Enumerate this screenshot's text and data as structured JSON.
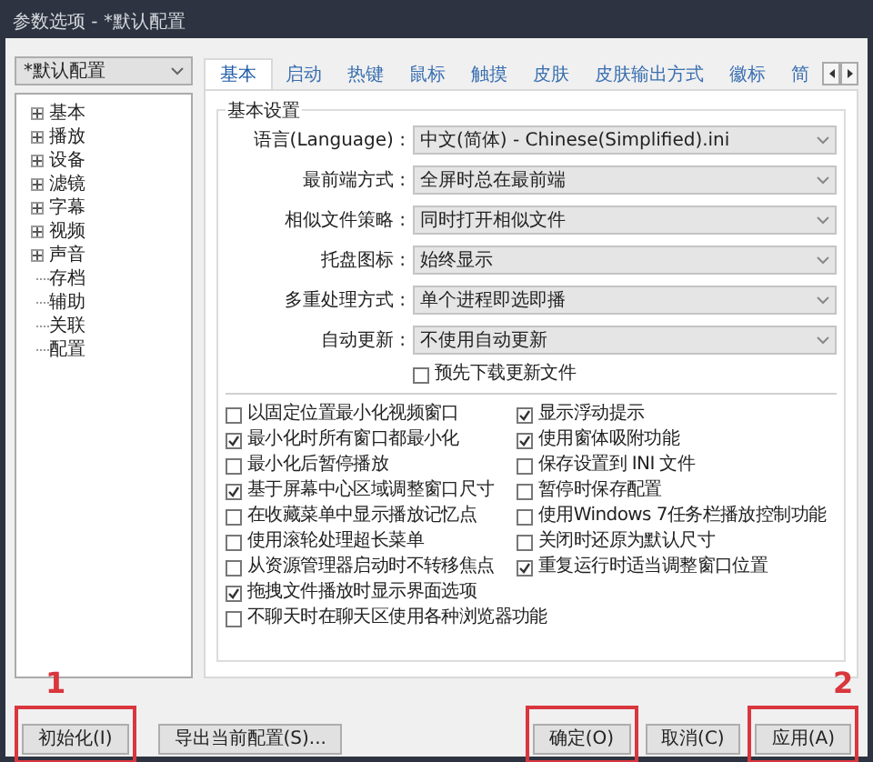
{
  "window": {
    "title": "参数选项 - *默认配置"
  },
  "profile_select": {
    "value": "*默认配置"
  },
  "tree": [
    {
      "label": "基本",
      "kind": "group"
    },
    {
      "label": "播放",
      "kind": "group"
    },
    {
      "label": "设备",
      "kind": "group"
    },
    {
      "label": "滤镜",
      "kind": "group"
    },
    {
      "label": "字幕",
      "kind": "group"
    },
    {
      "label": "视频",
      "kind": "group"
    },
    {
      "label": "声音",
      "kind": "group"
    },
    {
      "label": "存档",
      "kind": "leaf"
    },
    {
      "label": "辅助",
      "kind": "leaf"
    },
    {
      "label": "关联",
      "kind": "leaf"
    },
    {
      "label": "配置",
      "kind": "leaf"
    }
  ],
  "tabs": [
    {
      "label": "基本",
      "selected": true
    },
    {
      "label": "启动",
      "selected": false
    },
    {
      "label": "热键",
      "selected": false
    },
    {
      "label": "鼠标",
      "selected": false
    },
    {
      "label": "触摸",
      "selected": false
    },
    {
      "label": "皮肤",
      "selected": false
    },
    {
      "label": "皮肤输出方式",
      "selected": false
    },
    {
      "label": "徽标",
      "selected": false
    },
    {
      "label": "简",
      "selected": false
    }
  ],
  "group": {
    "title": "基本设置"
  },
  "settings": [
    {
      "label": "语言(Language) :",
      "value": "中文(简体) - Chinese(Simplified).ini"
    },
    {
      "label": "最前端方式 :",
      "value": "全屏时总在最前端"
    },
    {
      "label": "相似文件策略 :",
      "value": "同时打开相似文件"
    },
    {
      "label": "托盘图标 :",
      "value": "始终显示"
    },
    {
      "label": "多重处理方式 :",
      "value": "单个进程即选即播"
    },
    {
      "label": "自动更新 :",
      "value": "不使用自动更新"
    }
  ],
  "predownload": {
    "label": "预先下载更新文件",
    "checked": false
  },
  "options_left": [
    {
      "label": "以固定位置最小化视频窗口",
      "checked": false
    },
    {
      "label": "最小化时所有窗口都最小化",
      "checked": true
    },
    {
      "label": "最小化后暂停播放",
      "checked": false
    },
    {
      "label": "基于屏幕中心区域调整窗口尺寸",
      "checked": true
    },
    {
      "label": "在收藏菜单中显示播放记忆点",
      "checked": false
    },
    {
      "label": "使用滚轮处理超长菜单",
      "checked": false
    },
    {
      "label": "从资源管理器启动时不转移焦点",
      "checked": false
    },
    {
      "label": "拖拽文件播放时显示界面选项",
      "checked": true
    },
    {
      "label": "不聊天时在聊天区使用各种浏览器功能",
      "checked": false
    }
  ],
  "options_right": [
    {
      "label": "显示浮动提示",
      "checked": true
    },
    {
      "label": "使用窗体吸附功能",
      "checked": true
    },
    {
      "label": "保存设置到 INI 文件",
      "checked": false
    },
    {
      "label": "暂停时保存配置",
      "checked": false
    },
    {
      "label": "使用Windows 7任务栏播放控制功能",
      "checked": false
    },
    {
      "label": "关闭时还原为默认尺寸",
      "checked": false
    },
    {
      "label": "重复运行时适当调整窗口位置",
      "checked": true
    }
  ],
  "buttons_left": [
    {
      "label": "初始化(I)",
      "highlighted": true
    },
    {
      "label": "导出当前配置(S)...",
      "highlighted": false
    }
  ],
  "buttons_right": [
    {
      "label": "确定(O)",
      "highlighted": true
    },
    {
      "label": "取消(C)",
      "highlighted": false
    },
    {
      "label": "应用(A)",
      "highlighted": true
    }
  ],
  "annotations": [
    {
      "label": "1"
    },
    {
      "label": "2"
    }
  ]
}
